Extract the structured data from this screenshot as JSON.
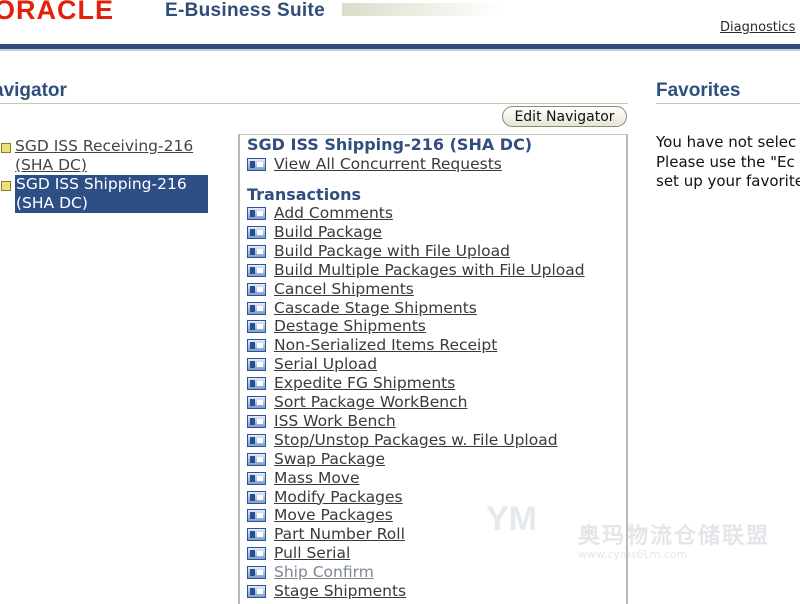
{
  "header": {
    "logo": "ORACLE",
    "suite_title": "E-Business Suite",
    "diagnostics_link": "Diagnostics"
  },
  "navigator": {
    "title": "avigator",
    "edit_button": "Edit Navigator",
    "responsibilities": [
      {
        "label": "SGD ISS Receiving-216 (SHA DC)",
        "selected": false
      },
      {
        "label": "SGD ISS Shipping-216 (SHA DC)",
        "selected": true
      }
    ],
    "selected_header": "SGD ISS Shipping-216 (SHA DC)",
    "top_link": "View All Concurrent Requests",
    "section_title": "Transactions",
    "functions": [
      "Add Comments",
      "Build Package",
      "Build Package with File Upload",
      "Build Multiple Packages with File Upload",
      "Cancel Shipments",
      "Cascade Stage Shipments",
      "Destage Shipments",
      "Non-Serialized Items Receipt",
      "Serial Upload",
      "Expedite FG Shipments",
      "Sort Package WorkBench",
      "ISS Work Bench",
      "Stop/Unstop Packages w. File Upload",
      "Swap Package",
      "Mass Move",
      "Modify Packages",
      "Move Packages",
      "Part Number Roll",
      "Pull Serial",
      "Ship Confirm",
      "Stage Shipments"
    ],
    "visited_function": "Ship Confirm"
  },
  "favorites": {
    "title": "Favorites",
    "message_lines": [
      "You have not selec",
      "Please use the \"Ec",
      "set up your favorite"
    ]
  },
  "watermark": {
    "text": "奥玛物流仓储联盟",
    "url": "www.cyms6Lm.com"
  },
  "colors": {
    "brand_red": "#e4200a",
    "header_blue": "#304e7e",
    "selection_blue": "#2e4f86"
  }
}
